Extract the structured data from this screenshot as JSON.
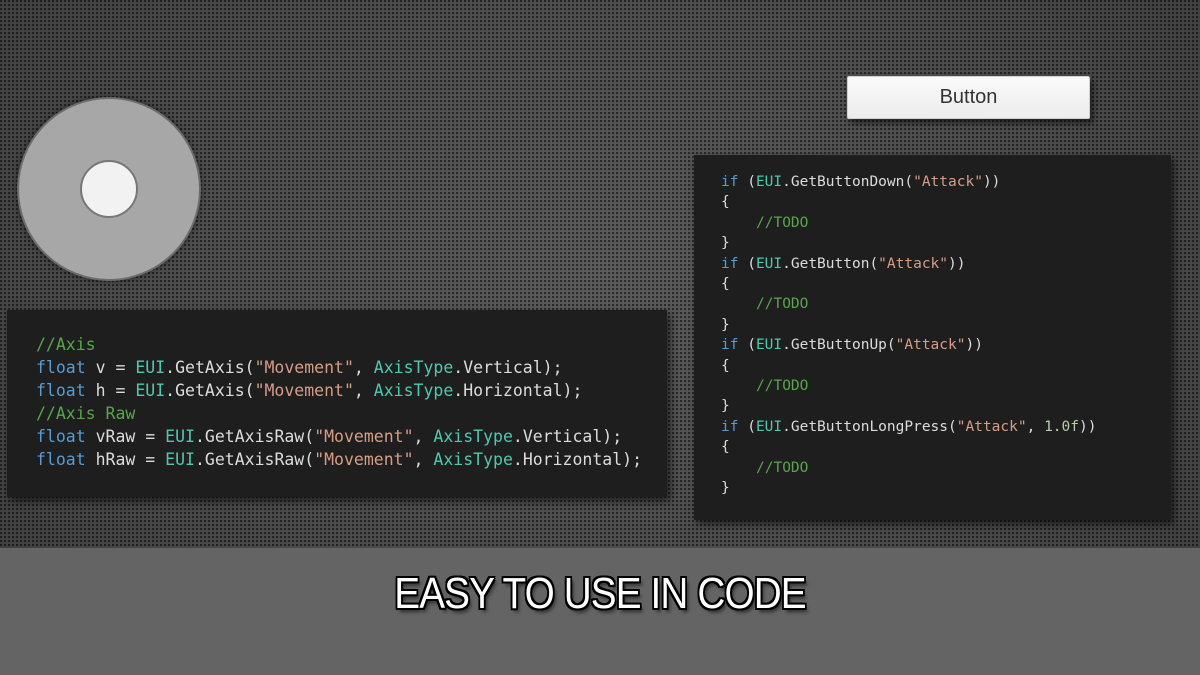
{
  "button": {
    "label": "Button"
  },
  "code_left": [
    [
      {
        "t": "//Axis",
        "c": "cmt"
      }
    ],
    [
      {
        "t": "float",
        "c": "kw"
      },
      {
        "t": " v = "
      },
      {
        "t": "EUI",
        "c": "cls"
      },
      {
        "t": ".GetAxis("
      },
      {
        "t": "\"Movement\"",
        "c": "str"
      },
      {
        "t": ", "
      },
      {
        "t": "AxisType",
        "c": "cls"
      },
      {
        "t": ".Vertical);"
      }
    ],
    [
      {
        "t": "float",
        "c": "kw"
      },
      {
        "t": " h = "
      },
      {
        "t": "EUI",
        "c": "cls"
      },
      {
        "t": ".GetAxis("
      },
      {
        "t": "\"Movement\"",
        "c": "str"
      },
      {
        "t": ", "
      },
      {
        "t": "AxisType",
        "c": "cls"
      },
      {
        "t": ".Horizontal);"
      }
    ],
    [
      {
        "t": "//Axis Raw",
        "c": "cmt"
      }
    ],
    [
      {
        "t": "float",
        "c": "kw"
      },
      {
        "t": " vRaw = "
      },
      {
        "t": "EUI",
        "c": "cls"
      },
      {
        "t": ".GetAxisRaw("
      },
      {
        "t": "\"Movement\"",
        "c": "str"
      },
      {
        "t": ", "
      },
      {
        "t": "AxisType",
        "c": "cls"
      },
      {
        "t": ".Vertical);"
      }
    ],
    [
      {
        "t": "float",
        "c": "kw"
      },
      {
        "t": " hRaw = "
      },
      {
        "t": "EUI",
        "c": "cls"
      },
      {
        "t": ".GetAxisRaw("
      },
      {
        "t": "\"Movement\"",
        "c": "str"
      },
      {
        "t": ", "
      },
      {
        "t": "AxisType",
        "c": "cls"
      },
      {
        "t": ".Horizontal);"
      }
    ]
  ],
  "code_right": [
    [
      {
        "t": "if",
        "c": "kw"
      },
      {
        "t": " ("
      },
      {
        "t": "EUI",
        "c": "cls"
      },
      {
        "t": ".GetButtonDown("
      },
      {
        "t": "\"Attack\"",
        "c": "str"
      },
      {
        "t": "))"
      }
    ],
    [
      {
        "t": "{"
      }
    ],
    [
      {
        "t": "",
        "c": "indent"
      },
      {
        "t": "//TODO",
        "c": "cmt"
      }
    ],
    [
      {
        "t": "}"
      }
    ],
    [
      {
        "t": "if",
        "c": "kw"
      },
      {
        "t": " ("
      },
      {
        "t": "EUI",
        "c": "cls"
      },
      {
        "t": ".GetButton("
      },
      {
        "t": "\"Attack\"",
        "c": "str"
      },
      {
        "t": "))"
      }
    ],
    [
      {
        "t": "{"
      }
    ],
    [
      {
        "t": "",
        "c": "indent"
      },
      {
        "t": "//TODO",
        "c": "cmt"
      }
    ],
    [
      {
        "t": "}"
      }
    ],
    [
      {
        "t": "if",
        "c": "kw"
      },
      {
        "t": " ("
      },
      {
        "t": "EUI",
        "c": "cls"
      },
      {
        "t": ".GetButtonUp("
      },
      {
        "t": "\"Attack\"",
        "c": "str"
      },
      {
        "t": "))"
      }
    ],
    [
      {
        "t": "{"
      }
    ],
    [
      {
        "t": "",
        "c": "indent"
      },
      {
        "t": "//TODO",
        "c": "cmt"
      }
    ],
    [
      {
        "t": "}"
      }
    ],
    [
      {
        "t": "if",
        "c": "kw"
      },
      {
        "t": " ("
      },
      {
        "t": "EUI",
        "c": "cls"
      },
      {
        "t": ".GetButtonLongPress("
      },
      {
        "t": "\"Attack\"",
        "c": "str"
      },
      {
        "t": ", "
      },
      {
        "t": "1.0f",
        "c": "num"
      },
      {
        "t": "))"
      }
    ],
    [
      {
        "t": "{"
      }
    ],
    [
      {
        "t": "",
        "c": "indent"
      },
      {
        "t": "//TODO",
        "c": "cmt"
      }
    ],
    [
      {
        "t": "}"
      }
    ]
  ],
  "footer": {
    "title": "EASY TO USE IN CODE"
  },
  "colors": {
    "keyword": "#569cd6",
    "type": "#4ec9b0",
    "string": "#d69d85",
    "comment": "#57a64a",
    "number": "#b5cea8",
    "code_background": "#1e1e1e"
  }
}
